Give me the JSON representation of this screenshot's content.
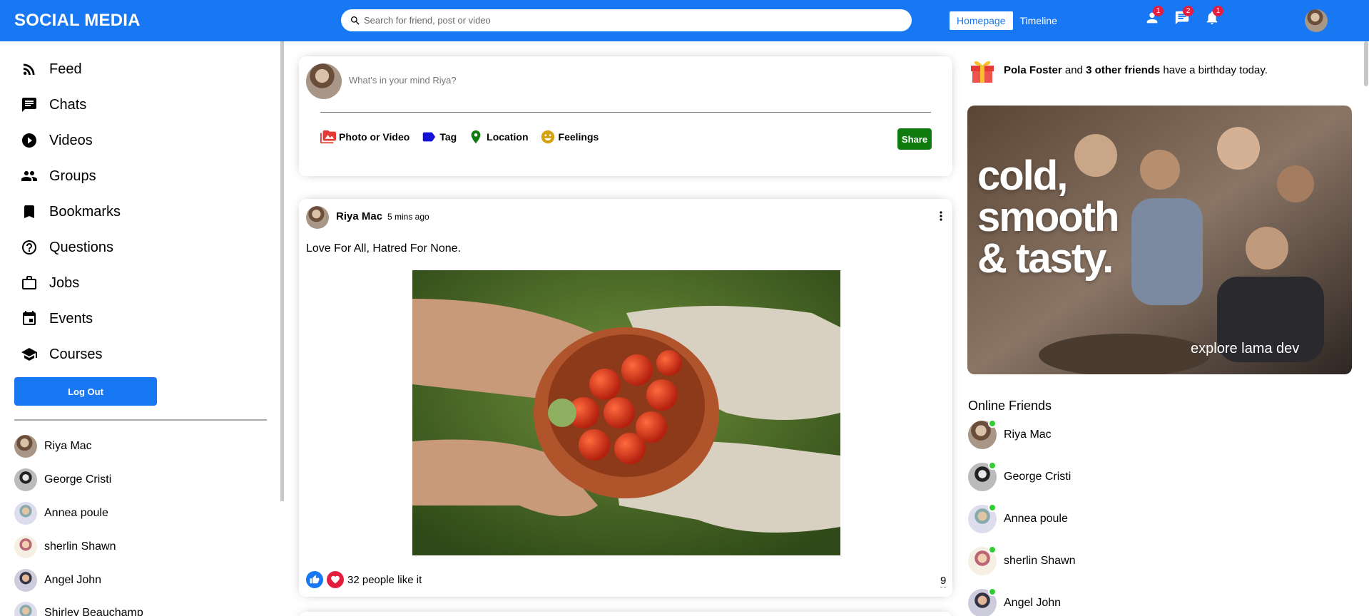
{
  "app": {
    "title": "SOCIAL MEDIA",
    "accent": "#1877f2"
  },
  "search": {
    "placeholder": "Search for friend, post or video"
  },
  "nav": {
    "homepage": "Homepage",
    "timeline": "Timeline"
  },
  "notifications": {
    "friends": "1",
    "messages": "2",
    "alerts": "1"
  },
  "sidebar": {
    "items": [
      {
        "label": "Feed",
        "icon": "rss-feed-icon"
      },
      {
        "label": "Chats",
        "icon": "chat-icon"
      },
      {
        "label": "Videos",
        "icon": "play-circle-icon"
      },
      {
        "label": "Groups",
        "icon": "group-icon"
      },
      {
        "label": "Bookmarks",
        "icon": "bookmark-icon"
      },
      {
        "label": "Questions",
        "icon": "help-icon"
      },
      {
        "label": "Jobs",
        "icon": "work-icon"
      },
      {
        "label": "Events",
        "icon": "event-icon"
      },
      {
        "label": "Courses",
        "icon": "school-icon"
      }
    ],
    "logout_label": "Log Out",
    "friends": [
      "Riya Mac",
      "George Cristi",
      "Annea poule",
      "sherlin Shawn",
      "Angel John",
      "Shirley Beauchamp"
    ]
  },
  "share": {
    "placeholder": "What's in your mind Riya?",
    "options": [
      "Photo or Video",
      "Tag",
      "Location",
      "Feelings"
    ],
    "share_label": "Share",
    "share_color": "#0f7b0f"
  },
  "post": {
    "username": "Riya Mac",
    "date": "5 mins ago",
    "text": "Love For All, Hatred For None.",
    "likes": "32 people like it",
    "comments": "9"
  },
  "birthday": {
    "name": "Pola Foster",
    "others": "3 other friends",
    "suffix": " have a birthday today.",
    "joiner": " and "
  },
  "ad": {
    "title_line1": "cold,",
    "title_line2": "smooth",
    "title_line3": "& tasty.",
    "subtitle": "explore lama dev"
  },
  "online": {
    "title": "Online Friends",
    "friends": [
      "Riya Mac",
      "George Cristi",
      "Annea poule",
      "sherlin Shawn",
      "Angel John"
    ]
  }
}
